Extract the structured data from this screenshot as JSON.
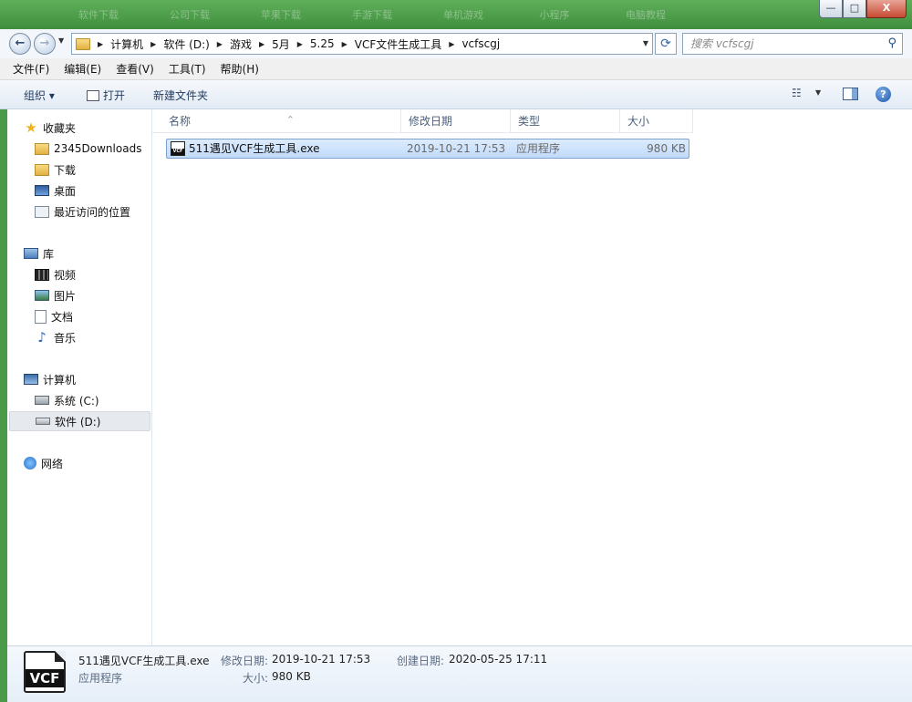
{
  "titlebar": {
    "background_tabs": [
      "软件下载",
      "公司下载",
      "苹果下载",
      "手游下载",
      "单机游戏",
      "小程序",
      "电脑教程"
    ],
    "minimize": "—",
    "maximize": "□",
    "close": "X"
  },
  "address": {
    "back": "←",
    "forward": "→",
    "breadcrumbs": [
      "计算机",
      "软件 (D:)",
      "游戏",
      "5月",
      "5.25",
      "VCF文件生成工具",
      "vcfscgj"
    ],
    "search_placeholder": "搜索 vcfscgj"
  },
  "menu": [
    "文件(F)",
    "编辑(E)",
    "查看(V)",
    "工具(T)",
    "帮助(H)"
  ],
  "commands": {
    "organize": "组织 ▾",
    "open": "打开",
    "new_folder": "新建文件夹",
    "help": "?"
  },
  "nav": {
    "favorites": "收藏夹",
    "favorites_items": [
      "2345Downloads",
      "下载",
      "桌面",
      "最近访问的位置"
    ],
    "libraries": "库",
    "libraries_items": [
      "视频",
      "图片",
      "文档",
      "音乐"
    ],
    "computer": "计算机",
    "computer_items": [
      "系统 (C:)",
      "软件 (D:)"
    ],
    "network": "网络"
  },
  "columns": [
    "名称",
    "修改日期",
    "类型",
    "大小"
  ],
  "files": [
    {
      "name": "511遇见VCF生成工具.exe",
      "modified": "2019-10-21 17:53",
      "type": "应用程序",
      "size": "980 KB",
      "icon_text": "VCF"
    }
  ],
  "details": {
    "filename": "511遇见VCF生成工具.exe",
    "type": "应用程序",
    "modified_label": "修改日期:",
    "modified": "2019-10-21 17:53",
    "created_label": "创建日期:",
    "created": "2020-05-25 17:11",
    "size_label": "大小:",
    "size": "980 KB",
    "icon_text": "VCF"
  },
  "colors": {
    "titlebar": "#4a9a4a",
    "selection": "#c1dbfc",
    "selection_border": "#7da2ce"
  }
}
